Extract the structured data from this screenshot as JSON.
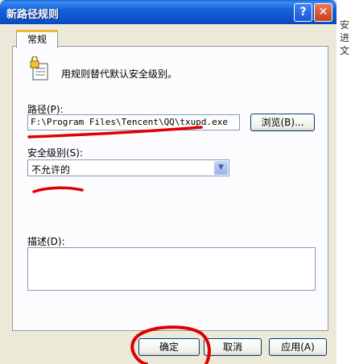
{
  "dialog": {
    "title": "新路径规则"
  },
  "titlebar": {
    "help_glyph": "?",
    "close_glyph": "✕"
  },
  "tabs": [
    {
      "label": "常规"
    }
  ],
  "info": {
    "text": "用规则替代默认安全级别。"
  },
  "path": {
    "label": "路径(P):",
    "value": "F:\\Program Files\\Tencent\\QQ\\txupd.exe",
    "browse_label": "浏览(B)..."
  },
  "security": {
    "label": "安全级别(S):",
    "value": "不允许的"
  },
  "description": {
    "label": "描述(D):",
    "value": ""
  },
  "buttons": {
    "ok": "确定",
    "cancel": "取消",
    "apply": "应用(A)"
  },
  "background": {
    "chars": [
      "安",
      "进",
      "文"
    ]
  },
  "colors": {
    "annotation": "#e00000",
    "titlebar": "#0b4fc6"
  }
}
